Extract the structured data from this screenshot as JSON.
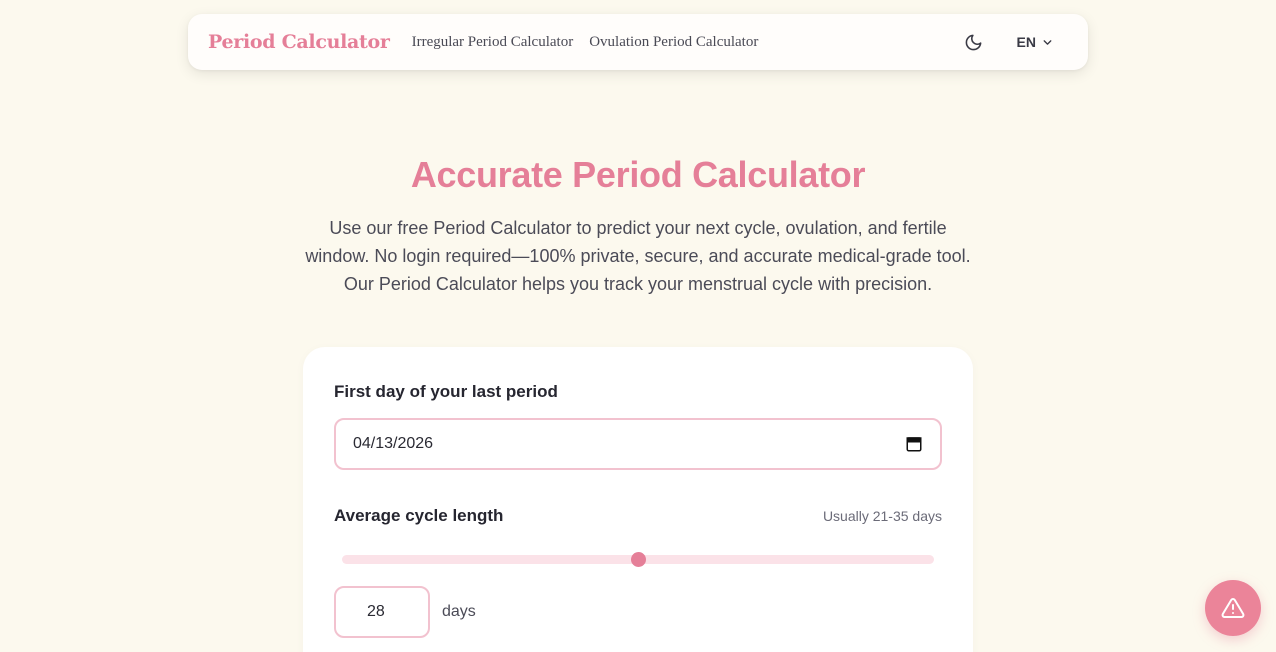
{
  "navbar": {
    "brand": "Period Calculator",
    "links": [
      "Irregular Period Calculator",
      "Ovulation Period Calculator"
    ],
    "theme_icon": "moon-icon",
    "language": "EN",
    "language_icon": "chevron-down-icon"
  },
  "hero": {
    "title": "Accurate Period Calculator",
    "description": "Use our free Period Calculator to predict your next cycle, ovulation, and fertile window. No login required—100% private, secure, and accurate medical-grade tool. Our Period Calculator helps you track your menstrual cycle with precision."
  },
  "form": {
    "last_period_label": "First day of your last period",
    "last_period_value": "04/13/2026",
    "calendar_icon": "calendar-icon",
    "cycle_label": "Average cycle length",
    "cycle_hint": "Usually 21-35 days",
    "cycle_slider": {
      "min": 21,
      "max": 35,
      "value": 28
    },
    "cycle_value": "28",
    "cycle_unit": "days"
  },
  "fab": {
    "icon": "warning-triangle-icon"
  },
  "colors": {
    "accent": "#e57f98",
    "background": "#fcf9ee",
    "input_border": "#f2c2cf",
    "slider_track": "#fbe2e8",
    "fab": "#eb8499"
  }
}
